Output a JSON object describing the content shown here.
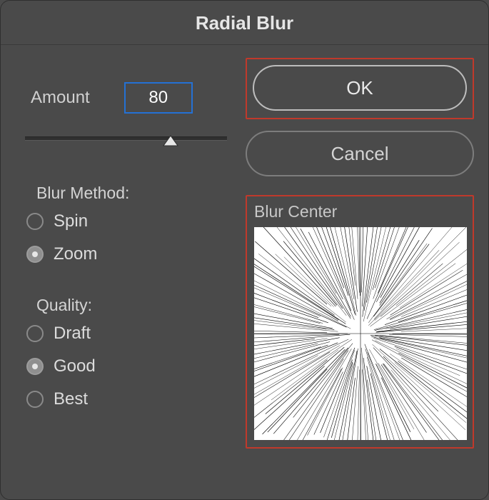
{
  "title": "Radial Blur",
  "amount": {
    "label": "Amount",
    "value": "80",
    "slider_percent": 72
  },
  "blur_method": {
    "title": "Blur Method:",
    "options": [
      {
        "label": "Spin",
        "value": "spin",
        "selected": false
      },
      {
        "label": "Zoom",
        "value": "zoom",
        "selected": true
      }
    ]
  },
  "quality": {
    "title": "Quality:",
    "options": [
      {
        "label": "Draft",
        "value": "draft",
        "selected": false
      },
      {
        "label": "Good",
        "value": "good",
        "selected": true
      },
      {
        "label": "Best",
        "value": "best",
        "selected": false
      }
    ]
  },
  "buttons": {
    "ok": "OK",
    "cancel": "Cancel"
  },
  "preview": {
    "title": "Blur Center"
  },
  "highlight_color": "#c0392b"
}
